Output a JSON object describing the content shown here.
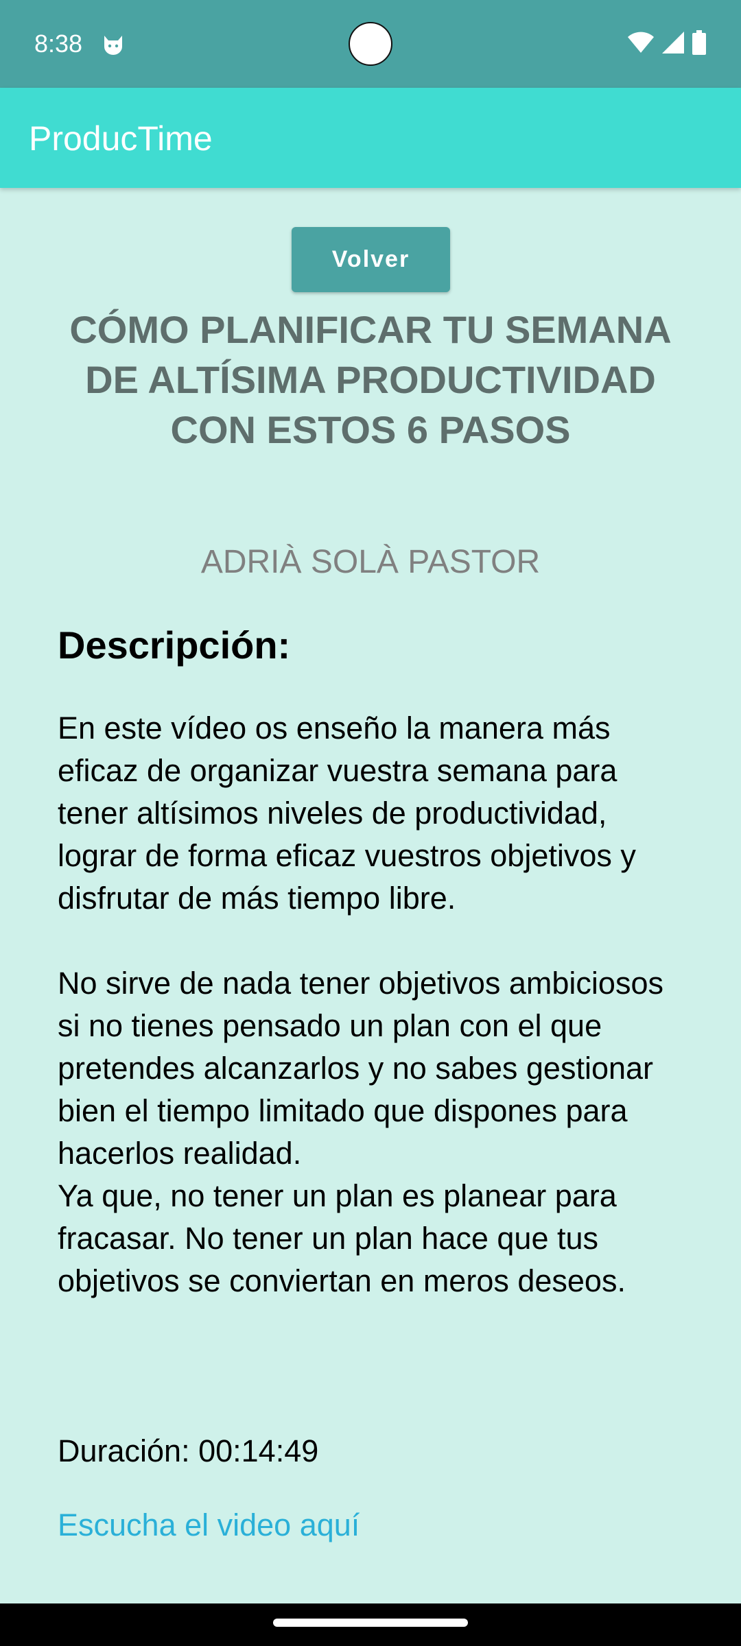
{
  "status_bar": {
    "time": "8:38",
    "icons": [
      "cat-notification-icon",
      "wifi-icon",
      "signal-icon",
      "battery-icon"
    ]
  },
  "app_bar": {
    "title": "ProducTime"
  },
  "content": {
    "back_label": "Volver",
    "title": "CÓMO PLANIFICAR TU SEMANA DE ALTÍSIMA PRODUCTIVIDAD CON ESTOS 6 PASOS",
    "author": "ADRIÀ SOLÀ PASTOR",
    "description_heading": "Descripción:",
    "description": "En este vídeo os enseño la manera más eficaz de organizar vuestra semana para tener altísimos niveles de productividad, lograr de forma eficaz vuestros objetivos y disfrutar de más tiempo libre.\n\nNo sirve de nada tener objetivos ambiciosos si no tienes pensado un plan con el que pretendes alcanzarlos y no sabes gestionar bien el tiempo limitado que dispones para hacerlos realidad.\nYa que, no tener un plan es planear para fracasar. No tener un plan hace que tus objetivos se conviertan en meros deseos.",
    "duration": "Duración: 00:14:49",
    "link_label": "Escucha el video aquí"
  },
  "colors": {
    "status_bar": "#4aa3a2",
    "app_bar": "#40dcd1",
    "background": "#cff1ea",
    "button": "#4aa3a2",
    "title_text": "#5e6e6c",
    "link": "#2ab0d8"
  }
}
